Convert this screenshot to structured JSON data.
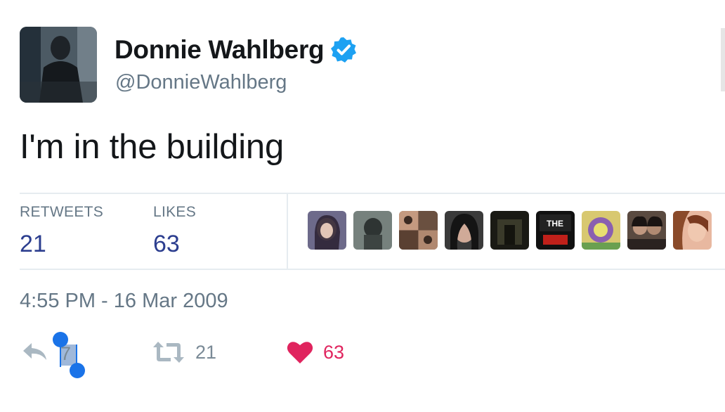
{
  "user": {
    "display_name": "Donnie Wahlberg",
    "handle": "@DonnieWahlberg",
    "verified": true,
    "avatar_icon": "profile-photo"
  },
  "tweet": {
    "text": "I'm in the building",
    "timestamp": "4:55 PM - 16 Mar 2009"
  },
  "stats": {
    "retweets_label": "RETWEETS",
    "retweets_value": "21",
    "likes_label": "LIKES",
    "likes_value": "63",
    "liker_count_shown": 9
  },
  "actions": {
    "reply_icon": "reply-arrow-icon",
    "reply_count": "7",
    "retweet_icon": "retweet-icon",
    "retweet_count": "21",
    "like_icon": "heart-icon",
    "like_count": "63"
  },
  "colors": {
    "verified_blue": "#1da1f2",
    "heart_red": "#e0245e",
    "stat_value": "#2c3e8f",
    "muted_gray": "#657786",
    "selection_handle": "#1a73e8"
  }
}
